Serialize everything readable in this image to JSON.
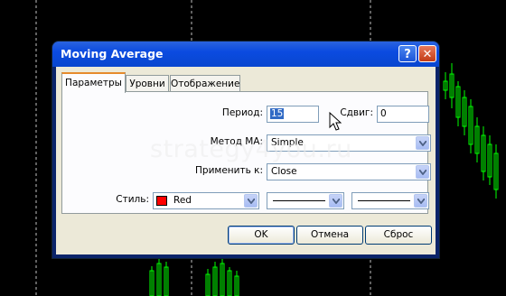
{
  "window": {
    "title": "Moving Average",
    "help_label": "?",
    "close_label": "✕"
  },
  "tabs": [
    {
      "label": "Параметры",
      "active": true
    },
    {
      "label": "Уровни",
      "active": false
    },
    {
      "label": "Отображение",
      "active": false
    }
  ],
  "params": {
    "period_label": "Период:",
    "period_value": "15",
    "shift_label": "Сдвиг:",
    "shift_value": "0",
    "method_label": "Метод МА:",
    "method_value": "Simple",
    "apply_label": "Применить к:",
    "apply_value": "Close",
    "style_label": "Стиль:",
    "color_value": "Red",
    "color_hex": "#ff0000"
  },
  "buttons": {
    "ok": "OK",
    "cancel": "Отмена",
    "reset": "Сброс"
  },
  "watermark": "strategy4you.ru",
  "colors": {
    "title_bar": "#0b4be0",
    "tab_accent": "#e68b2c",
    "chart_candles": "#00ff00",
    "chart_grid": "#c0c0c0"
  },
  "icons": [
    "help-icon",
    "close-icon",
    "chevron-down-icon",
    "mouse-cursor-icon"
  ]
}
